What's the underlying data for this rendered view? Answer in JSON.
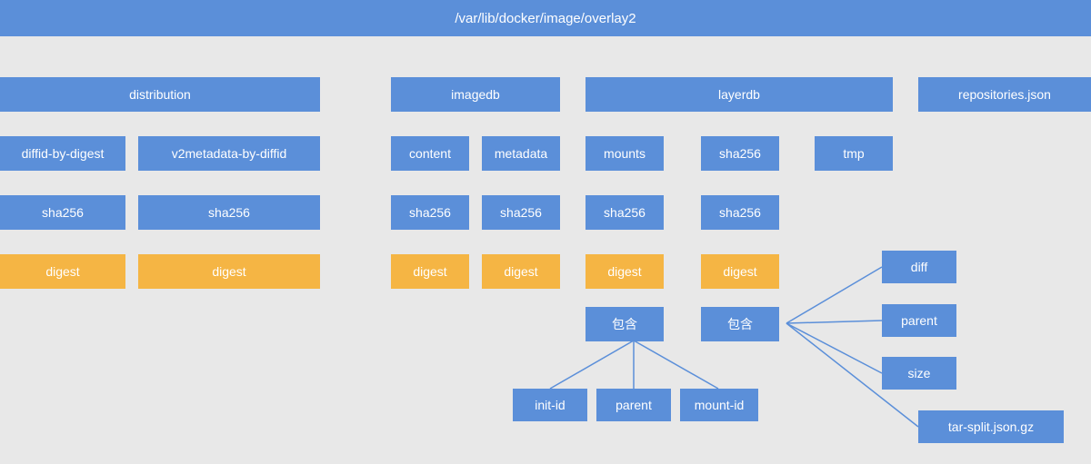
{
  "root": "/var/lib/docker/image/overlay2",
  "level1": {
    "distribution": "distribution",
    "imagedb": "imagedb",
    "layerdb": "layerdb",
    "repositories": "repositories.json"
  },
  "distribution": {
    "diffid_by_digest": "diffid-by-digest",
    "v2metadata_by_diffid": "v2metadata-by-diffid",
    "sha256_left": "sha256",
    "sha256_right": "sha256",
    "digest_left": "digest",
    "digest_right": "digest"
  },
  "imagedb": {
    "content": "content",
    "metadata": "metadata",
    "sha256_left": "sha256",
    "sha256_right": "sha256",
    "digest_left": "digest",
    "digest_right": "digest"
  },
  "layerdb": {
    "mounts": "mounts",
    "sha256_header": "sha256",
    "tmp": "tmp",
    "sha256_left": "sha256",
    "sha256_right": "sha256",
    "digest_left": "digest",
    "digest_right": "digest",
    "contains_left": "包含",
    "contains_right": "包含"
  },
  "mounts_children": {
    "init_id": "init-id",
    "parent": "parent",
    "mount_id": "mount-id"
  },
  "sha256_children": {
    "diff": "diff",
    "parent": "parent",
    "size": "size",
    "tar_split": "tar-split.json.gz"
  }
}
